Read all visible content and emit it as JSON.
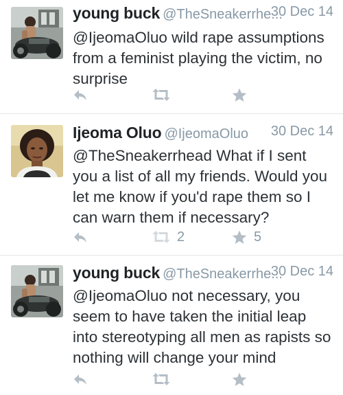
{
  "tweets": [
    {
      "name": "young buck",
      "handle": "@TheSneakerrhe",
      "ellipsis": "...",
      "time": "30 Dec 14",
      "text": "@IjeomaOluo wild rape assumptions from a feminist playing the victim, no surprise",
      "retweets": "",
      "favorites": "",
      "avatar_icon": "motorcycle-photo-avatar"
    },
    {
      "name": "Ijeoma Oluo",
      "handle": "@IjeomaOluo",
      "ellipsis": "",
      "time": "30 Dec 14",
      "text": "@TheSneakerrhead What if I sent you a list of all my friends. Would you let me know if you'd rape them so I can warn them if necessary?",
      "retweets": "2",
      "favorites": "5",
      "avatar_icon": "woman-portrait-avatar"
    },
    {
      "name": "young buck",
      "handle": "@TheSneakerrhe",
      "ellipsis": "...",
      "time": "30 Dec 14",
      "text": "@IjeomaOluo not necessary, you seem to have taken the initial leap into stereotyping all men as rapists so nothing will change your mind",
      "retweets": "",
      "favorites": "",
      "avatar_icon": "motorcycle-photo-avatar"
    }
  ],
  "colors": {
    "name": "#1f2326",
    "meta": "#8899a6",
    "text": "#2c3135",
    "icon": "#b5bec6",
    "divider": "#e6e6e6"
  }
}
